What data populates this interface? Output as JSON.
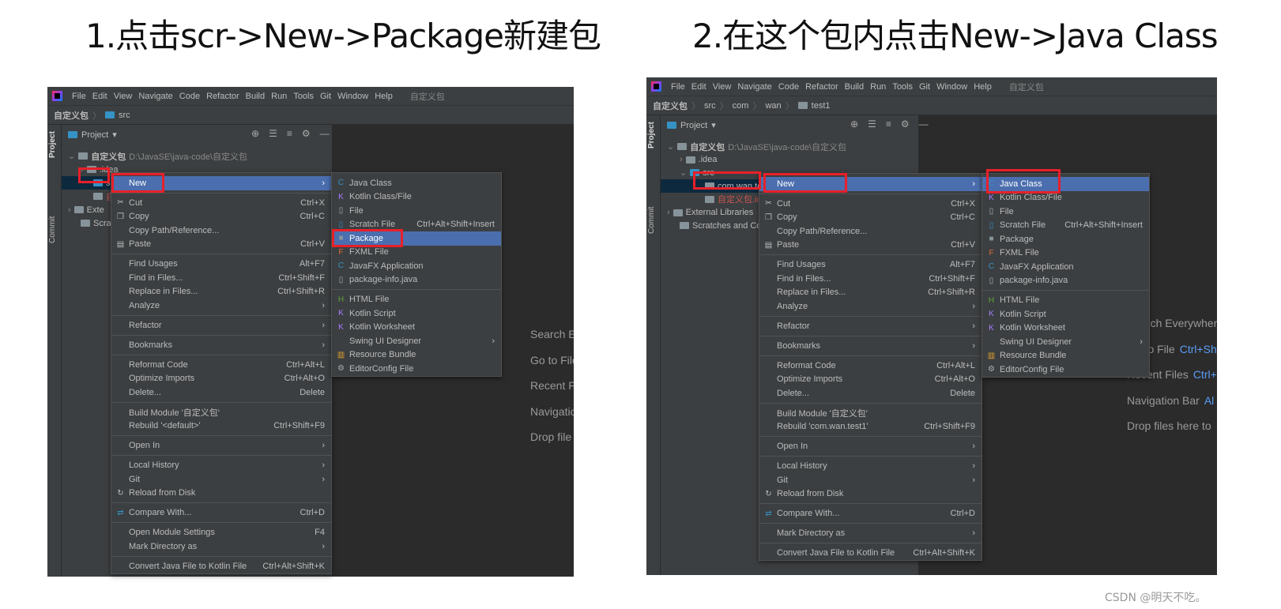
{
  "titles": {
    "step1": "1.点击scr->New->Package新建包",
    "step2": "2.在这个包内点击New->Java Class"
  },
  "watermark": "CSDN @明天不吃。",
  "colors": {
    "highlight": "#e8202a",
    "selection": "#4b6eaf",
    "menu_bg": "#3c3f41",
    "editor_bg": "#2b2b2b"
  },
  "menubar": [
    "File",
    "Edit",
    "View",
    "Navigate",
    "Code",
    "Refactor",
    "Build",
    "Run",
    "Tools",
    "Git",
    "Window",
    "Help"
  ],
  "project_name": "自定义包",
  "left": {
    "breadcrumb": [
      "自定义包",
      "src"
    ],
    "pane_title": "Project",
    "side_tabs": [
      "Project",
      "Commit"
    ],
    "tree": [
      {
        "label": "自定义包",
        "path": "D:\\JavaSE\\java-code\\自定义包"
      },
      {
        "label": ".idea"
      },
      {
        "label": "s"
      },
      {
        "label": "自"
      },
      {
        "label": "Exte"
      },
      {
        "label": "Scra"
      }
    ],
    "hints": [
      {
        "text": "Search E"
      },
      {
        "text": "Go to File"
      },
      {
        "text": "Recent F"
      },
      {
        "text": "Navigatio"
      },
      {
        "text": "Drop file"
      }
    ],
    "menu": [
      {
        "label": "New",
        "arrow": true,
        "sel": true
      },
      {
        "sep": true
      },
      {
        "label": "Cut",
        "sc": "Ctrl+X",
        "icon": "scissors-icon"
      },
      {
        "label": "Copy",
        "sc": "Ctrl+C",
        "icon": "copy-icon"
      },
      {
        "label": "Copy Path/Reference..."
      },
      {
        "label": "Paste",
        "sc": "Ctrl+V",
        "icon": "paste-icon"
      },
      {
        "sep": true
      },
      {
        "label": "Find Usages",
        "sc": "Alt+F7"
      },
      {
        "label": "Find in Files...",
        "sc": "Ctrl+Shift+F"
      },
      {
        "label": "Replace in Files...",
        "sc": "Ctrl+Shift+R"
      },
      {
        "label": "Analyze",
        "arrow": true
      },
      {
        "sep": true
      },
      {
        "label": "Refactor",
        "arrow": true
      },
      {
        "sep": true
      },
      {
        "label": "Bookmarks",
        "arrow": true
      },
      {
        "sep": true
      },
      {
        "label": "Reformat Code",
        "sc": "Ctrl+Alt+L"
      },
      {
        "label": "Optimize Imports",
        "sc": "Ctrl+Alt+O"
      },
      {
        "label": "Delete...",
        "sc": "Delete"
      },
      {
        "sep": true
      },
      {
        "label": "Build Module '自定义包'"
      },
      {
        "label": "Rebuild '<default>'",
        "sc": "Ctrl+Shift+F9"
      },
      {
        "sep": true
      },
      {
        "label": "Open In",
        "arrow": true
      },
      {
        "sep": true
      },
      {
        "label": "Local History",
        "arrow": true
      },
      {
        "label": "Git",
        "arrow": true
      },
      {
        "label": "Reload from Disk",
        "icon": "reload-icon"
      },
      {
        "sep": true
      },
      {
        "label": "Compare With...",
        "sc": "Ctrl+D",
        "icon": "compare-icon"
      },
      {
        "sep": true
      },
      {
        "label": "Open Module Settings",
        "sc": "F4"
      },
      {
        "label": "Mark Directory as",
        "arrow": true
      },
      {
        "sep": true
      },
      {
        "label": "Convert Java File to Kotlin File",
        "sc": "Ctrl+Alt+Shift+K"
      }
    ],
    "submenu_selected": "Package"
  },
  "right": {
    "breadcrumb": [
      "自定义包",
      "src",
      "com",
      "wan",
      "test1"
    ],
    "pane_title": "Project",
    "side_tabs": [
      "Project",
      "Commit"
    ],
    "tree": [
      {
        "label": "自定义包",
        "path": "D:\\JavaSE\\java-code\\自定义包"
      },
      {
        "label": ".idea"
      },
      {
        "label": "src"
      },
      {
        "label": "com.wan.test1"
      },
      {
        "label": "自定义包.iml"
      },
      {
        "label": "External Libraries"
      },
      {
        "label": "Scratches and Con"
      }
    ],
    "hints": [
      {
        "text": "Search Everywhere"
      },
      {
        "text": "Go to File",
        "sc": "Ctrl+Sh"
      },
      {
        "text": "Recent Files",
        "sc": "Ctrl+"
      },
      {
        "text": "Navigation Bar",
        "sc": "Al"
      },
      {
        "text": "Drop files here to"
      }
    ],
    "menu": [
      {
        "label": "New",
        "arrow": true,
        "sel": true
      },
      {
        "sep": true
      },
      {
        "label": "Cut",
        "sc": "Ctrl+X",
        "icon": "scissors-icon"
      },
      {
        "label": "Copy",
        "sc": "Ctrl+C",
        "icon": "copy-icon"
      },
      {
        "label": "Copy Path/Reference..."
      },
      {
        "label": "Paste",
        "sc": "Ctrl+V",
        "icon": "paste-icon"
      },
      {
        "sep": true
      },
      {
        "label": "Find Usages",
        "sc": "Alt+F7"
      },
      {
        "label": "Find in Files...",
        "sc": "Ctrl+Shift+F"
      },
      {
        "label": "Replace in Files...",
        "sc": "Ctrl+Shift+R"
      },
      {
        "label": "Analyze",
        "arrow": true
      },
      {
        "sep": true
      },
      {
        "label": "Refactor",
        "arrow": true
      },
      {
        "sep": true
      },
      {
        "label": "Bookmarks",
        "arrow": true
      },
      {
        "sep": true
      },
      {
        "label": "Reformat Code",
        "sc": "Ctrl+Alt+L"
      },
      {
        "label": "Optimize Imports",
        "sc": "Ctrl+Alt+O"
      },
      {
        "label": "Delete...",
        "sc": "Delete"
      },
      {
        "sep": true
      },
      {
        "label": "Build Module '自定义包'"
      },
      {
        "label": "Rebuild 'com.wan.test1'",
        "sc": "Ctrl+Shift+F9"
      },
      {
        "sep": true
      },
      {
        "label": "Open In",
        "arrow": true
      },
      {
        "sep": true
      },
      {
        "label": "Local History",
        "arrow": true
      },
      {
        "label": "Git",
        "arrow": true
      },
      {
        "label": "Reload from Disk",
        "icon": "reload-icon"
      },
      {
        "sep": true
      },
      {
        "label": "Compare With...",
        "sc": "Ctrl+D",
        "icon": "compare-icon"
      },
      {
        "sep": true
      },
      {
        "label": "Mark Directory as",
        "arrow": true
      },
      {
        "sep": true
      },
      {
        "label": "Convert Java File to Kotlin File",
        "sc": "Ctrl+Alt+Shift+K"
      }
    ],
    "submenu_selected": "Java Class"
  },
  "submenu": [
    {
      "label": "Java Class",
      "icon": "java-class-icon"
    },
    {
      "label": "Kotlin Class/File",
      "icon": "kotlin-icon"
    },
    {
      "label": "File",
      "icon": "file-icon"
    },
    {
      "label": "Scratch File",
      "sc": "Ctrl+Alt+Shift+Insert",
      "icon": "scratch-icon"
    },
    {
      "label": "Package",
      "icon": "package-icon"
    },
    {
      "label": "FXML File",
      "icon": "fxml-icon"
    },
    {
      "label": "JavaFX Application",
      "icon": "javafx-icon"
    },
    {
      "label": "package-info.java",
      "icon": "file-icon"
    },
    {
      "sep": true
    },
    {
      "label": "HTML File",
      "icon": "html-icon"
    },
    {
      "label": "Kotlin Script",
      "icon": "kotlin-icon"
    },
    {
      "label": "Kotlin Worksheet",
      "icon": "kotlin-icon"
    },
    {
      "label": "Swing UI Designer",
      "arrow": true
    },
    {
      "label": "Resource Bundle",
      "icon": "resource-bundle-icon"
    },
    {
      "label": "EditorConfig File",
      "icon": "gear-icon"
    }
  ]
}
